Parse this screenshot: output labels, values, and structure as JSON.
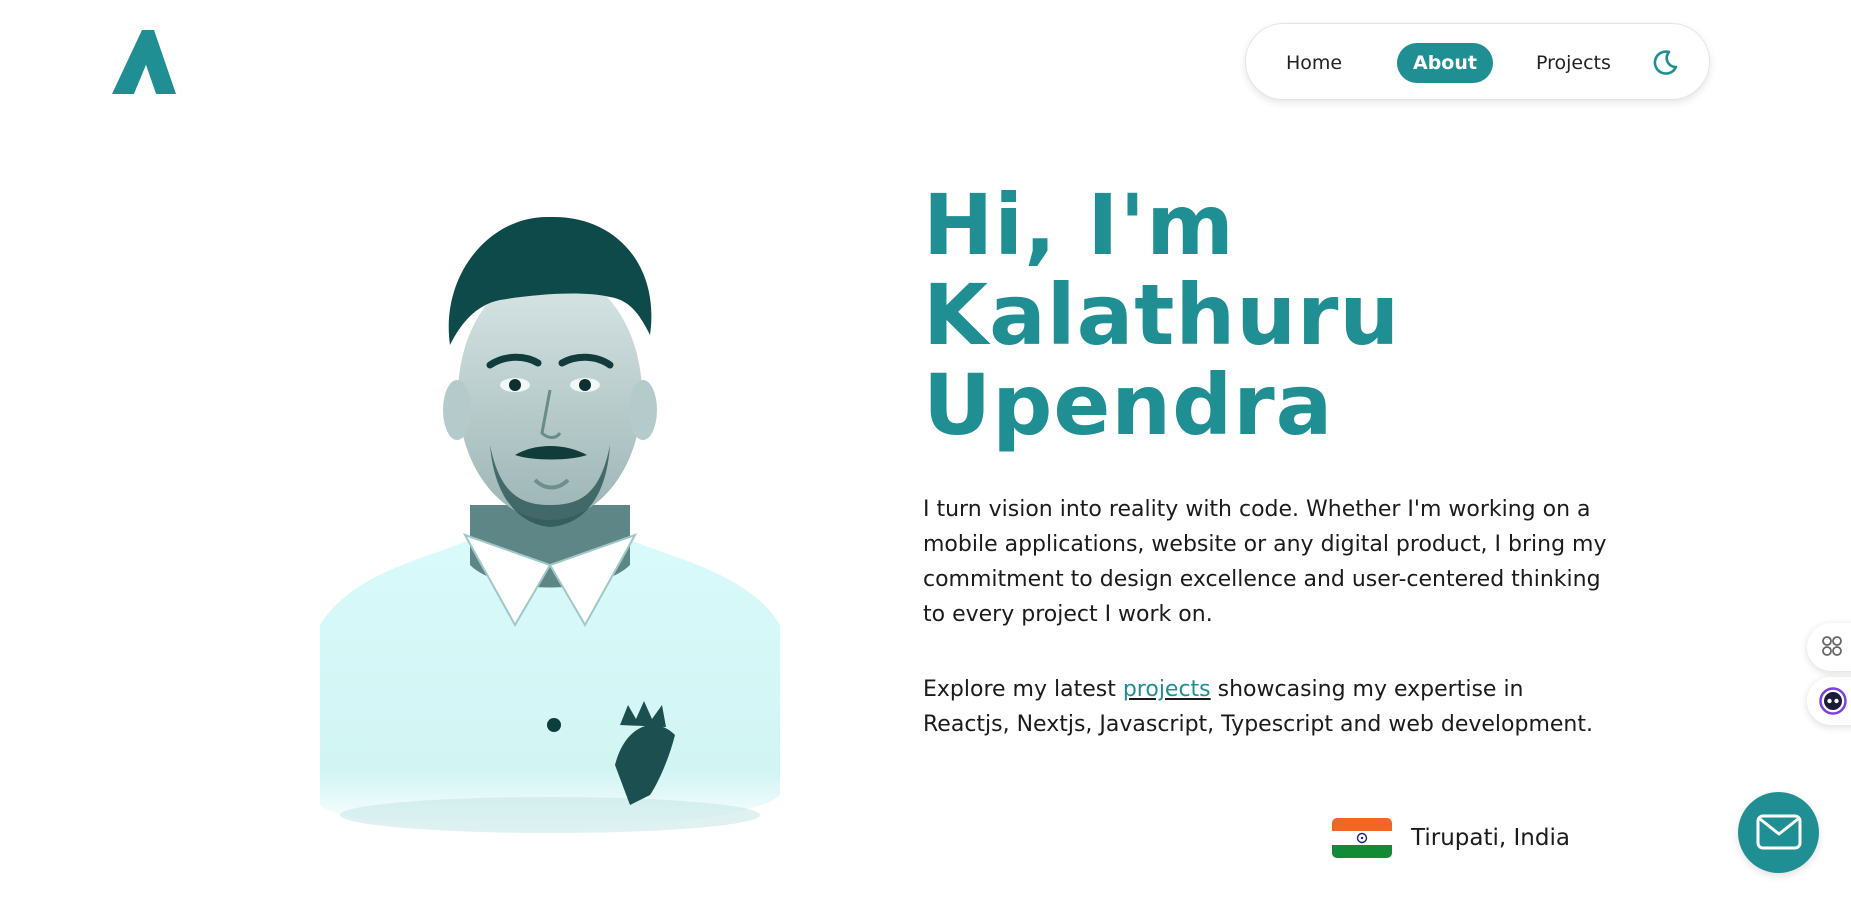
{
  "colors": {
    "accent": "#1f8f94",
    "text": "#1b1b1b",
    "background": "#ffffff"
  },
  "header": {
    "logo_icon": "triangle-a-logo",
    "nav": {
      "items": [
        {
          "label": "Home",
          "active": false
        },
        {
          "label": "About",
          "active": true
        },
        {
          "label": "Projects",
          "active": false
        }
      ],
      "theme_toggle_icon": "moon-icon"
    }
  },
  "hero": {
    "title_lines": [
      "Hi, I'm",
      "Kalathuru",
      "Upendra"
    ],
    "intro": "I turn vision into reality with code. Whether I'm working on a mobile applications, website or any digital product, I bring my commitment to design excellence and user-centered thinking to every project I work on.",
    "explore": {
      "before": "Explore my latest ",
      "link": "projects",
      "after": " showcasing my expertise in Reactjs, Nextjs, Javascript, Typescript and web development."
    },
    "location": {
      "flag_icon": "india-flag-icon",
      "text": "Tirupati, India"
    },
    "portrait_icon": "profile-portrait"
  },
  "widgets": {
    "side_top_icon": "command-icon",
    "side_bottom_icon": "assistant-face-icon",
    "mail_icon": "mail-icon"
  }
}
